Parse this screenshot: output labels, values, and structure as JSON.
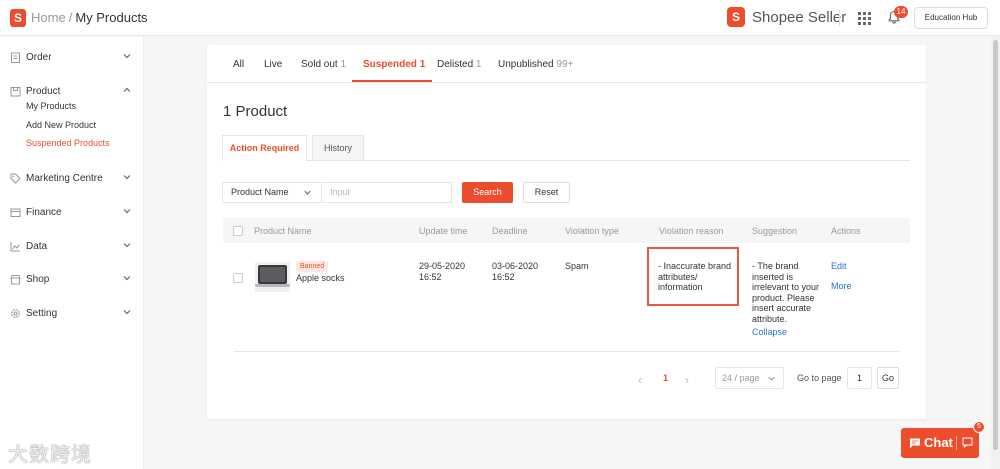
{
  "header": {
    "logo_letter": "S",
    "breadcrumb_home": "Home",
    "breadcrumb_separator": "/",
    "breadcrumb_current": "My Products",
    "seller_logo_letter": "S",
    "seller_title": "Shopee Seller",
    "notification_count": "14",
    "education_hub_label": "Education Hub",
    "brand_color": "#ee4d2d"
  },
  "sidebar": {
    "order": "Order",
    "product": "Product",
    "product_items": [
      "My Products",
      "Add New Product",
      "Suspended Products"
    ],
    "marketing": "Marketing Centre",
    "finance": "Finance",
    "data": "Data",
    "shop": "Shop",
    "setting": "Setting"
  },
  "tabs": [
    {
      "label": "All",
      "count": ""
    },
    {
      "label": "Live",
      "count": ""
    },
    {
      "label": "Sold out",
      "count": "1"
    },
    {
      "label": "Suspended",
      "count": "1"
    },
    {
      "label": "Delisted",
      "count": "1"
    },
    {
      "label": "Unpublished",
      "count": "99+"
    }
  ],
  "main": {
    "product_count_title": "1 Product",
    "subtab_action_required": "Action Required",
    "subtab_history": "History"
  },
  "filter": {
    "field_select_value": "Product Name",
    "input_placeholder": "Input",
    "search_label": "Search",
    "reset_label": "Reset"
  },
  "table": {
    "columns": [
      "Product Name",
      "Update time",
      "Deadline",
      "Violation type",
      "Violation reason",
      "Suggestion",
      "Actions"
    ],
    "row": {
      "badge": "Banned",
      "product_name": "Apple socks",
      "update_date": "29-05-2020",
      "update_time": "16:52",
      "deadline_date": "03-06-2020",
      "deadline_time": "16:52",
      "violation_type": "Spam",
      "violation_reason": [
        "- Inaccurate brand",
        "attributes/",
        "information"
      ],
      "suggestion": [
        "- The brand",
        "inserted is",
        "irrelevant to your",
        "product. Please",
        "insert accurate",
        "attribute."
      ],
      "collapse_label": "Collapse",
      "action_edit": "Edit",
      "action_more": "More"
    }
  },
  "pagination": {
    "prev": "‹",
    "current_page": "1",
    "next": "›",
    "page_size": "24 / page",
    "goto_label": "Go to page",
    "goto_value": "1",
    "go_button": "Go"
  },
  "chat": {
    "label": "Chat",
    "badge": "5"
  },
  "watermark": "大数跨境"
}
